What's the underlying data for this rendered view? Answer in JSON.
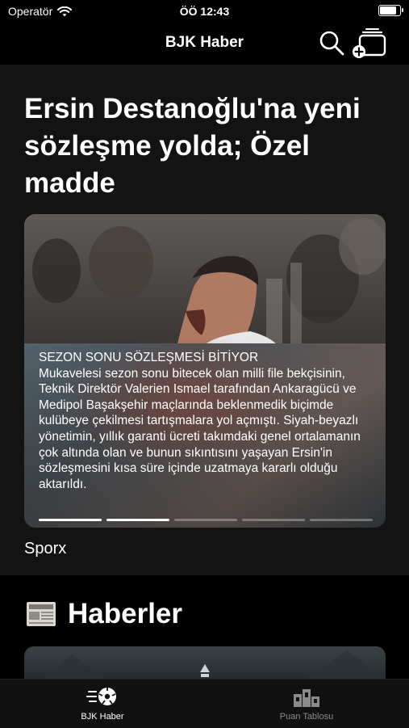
{
  "status_bar": {
    "carrier": "Operatör",
    "time": "ÖÖ 12:43",
    "battery_level": 0.92
  },
  "nav": {
    "title": "BJK Haber",
    "search_icon": "search-icon",
    "add_icon": "add-to-stack-icon"
  },
  "hero": {
    "title": "Ersin Destanoğlu'na yeni sözleşme yolda; Özel madde",
    "card": {
      "heading": "SEZON SONU SÖZLEŞMESİ BİTİYOR",
      "body": "Mukavelesi sezon sonu bitecek olan milli file bekçisinin, Teknik Direktör Valerien Ismael tarafından Ankaragücü ve Medipol Başakşehir maçlarında beklenmedik biçimde kulübeye çekilmesi tartışmalara yol açmıştı. Siyah-beyazlı yönetimin, yıllık garanti ücreti takımdaki genel ortalamanın çok altında olan ve bunun sıkıntısını yaşayan Ersin'in sözleşmesini kısa süre içinde uzatmaya kararlı olduğu aktarıldı.",
      "progress": [
        1,
        1,
        0,
        0,
        0
      ]
    },
    "source": "Sporx"
  },
  "section": {
    "title": "Haberler",
    "icon": "newspaper-icon"
  },
  "tabs": [
    {
      "label": "BJK Haber",
      "icon": "soccer-ball-speed-icon",
      "active": true
    },
    {
      "label": "Puan Tablosu",
      "icon": "podium-icon",
      "active": false
    }
  ],
  "colors": {
    "background": "#000000",
    "hero_background": "#131313",
    "tab_inactive": "#8a8a8a"
  }
}
